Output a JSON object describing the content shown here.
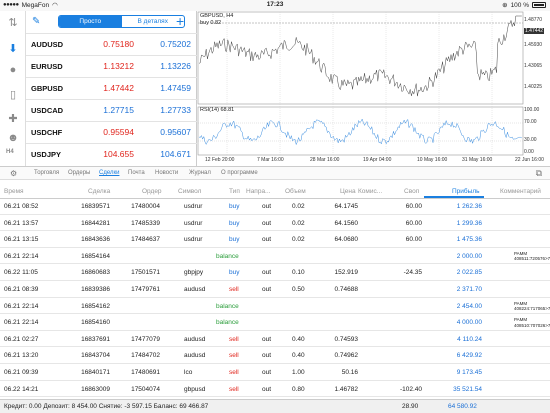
{
  "status_bar": {
    "carrier": "MegaFon",
    "time": "17:23",
    "battery": "100 %"
  },
  "quotes": {
    "tabs": [
      "Просто",
      "В деталях"
    ],
    "rows": [
      {
        "symbol": "AUDUSD",
        "bid": "0.75180",
        "ask": "0.75202",
        "bid_color": "red",
        "ask_color": "blue"
      },
      {
        "symbol": "EURUSD",
        "bid": "1.13212",
        "ask": "1.13226",
        "bid_color": "red",
        "ask_color": "blue"
      },
      {
        "symbol": "GBPUSD",
        "bid": "1.47442",
        "ask": "1.47459",
        "bid_color": "red",
        "ask_color": "blue"
      },
      {
        "symbol": "USDCAD",
        "bid": "1.27715",
        "ask": "1.27733",
        "bid_color": "blue",
        "ask_color": "blue"
      },
      {
        "symbol": "USDCHF",
        "bid": "0.95594",
        "ask": "0.95607",
        "bid_color": "red",
        "ask_color": "blue"
      },
      {
        "symbol": "USDJPY",
        "bid": "104.655",
        "ask": "104.671",
        "bid_color": "red",
        "ask_color": "blue"
      }
    ],
    "timeframe": "H4"
  },
  "chart": {
    "title": "GBPUSD, H4",
    "buy_label": "buy 0.82",
    "price_tag": "1.47442",
    "y_labels": [
      "1.48770",
      "1.45930",
      "1.43065",
      "1.40225"
    ],
    "rsi_label": "RSI(14) 68.81",
    "rsi_labels": [
      "100.00",
      "70.00",
      "30.00",
      "0.00"
    ],
    "x_labels": [
      "12 Feb 20:00",
      "7 Mar 16:00",
      "28 Mar 16:00",
      "19 Apr 04:00",
      "10 May 16:00",
      "31 May 16:00",
      "22 Jun 16:00"
    ]
  },
  "tabs": {
    "items": [
      "Торговля",
      "Ордеры",
      "Сделки",
      "Почта",
      "Новости",
      "Журнал",
      "О программе"
    ],
    "active": "Сделки"
  },
  "table": {
    "headers": [
      "Время",
      "Сделка",
      "Ордер",
      "Символ",
      "Тип",
      "Напра...",
      "Объем",
      "Цена",
      "Комис...",
      "Своп",
      "Прибыль",
      "Комментарий"
    ],
    "rows": [
      {
        "time": "06.21 08:52",
        "deal": "16839571",
        "order": "17480004",
        "symbol": "usdrur",
        "type": "buy",
        "dir": "out",
        "volume": "0.02",
        "price": "64.1745",
        "commission": "",
        "swap": "60.00",
        "profit": "1 262.36",
        "comment": ""
      },
      {
        "time": "06.21 13:57",
        "deal": "16844281",
        "order": "17485339",
        "symbol": "usdrur",
        "type": "buy",
        "dir": "out",
        "volume": "0.02",
        "price": "64.1560",
        "commission": "",
        "swap": "60.00",
        "profit": "1 299.36",
        "comment": ""
      },
      {
        "time": "06.21 13:15",
        "deal": "16843636",
        "order": "17484637",
        "symbol": "usdrur",
        "type": "buy",
        "dir": "out",
        "volume": "0.02",
        "price": "64.0680",
        "commission": "",
        "swap": "60.00",
        "profit": "1 475.36",
        "comment": ""
      },
      {
        "time": "06.21 22:14",
        "deal": "16854164",
        "order": "",
        "symbol": "",
        "type": "balance",
        "dir": "",
        "volume": "",
        "price": "",
        "commission": "",
        "swap": "",
        "profit": "2 000.00",
        "comment": "PAMM 408511:720576>711208"
      },
      {
        "time": "06.22 11:05",
        "deal": "16860683",
        "order": "17501571",
        "symbol": "gbpjpy",
        "type": "buy",
        "dir": "out",
        "volume": "0.10",
        "price": "152.919",
        "commission": "",
        "swap": "-24.35",
        "profit": "2 022.85",
        "comment": ""
      },
      {
        "time": "06.21 08:39",
        "deal": "16839386",
        "order": "17479761",
        "symbol": "audusd",
        "type": "sell",
        "dir": "out",
        "volume": "0.50",
        "price": "0.74688",
        "commission": "",
        "swap": "",
        "profit": "2 371.70",
        "comment": ""
      },
      {
        "time": "06.21 22:14",
        "deal": "16854162",
        "order": "",
        "symbol": "",
        "type": "balance",
        "dir": "",
        "volume": "",
        "price": "",
        "commission": "",
        "swap": "",
        "profit": "2 454.00",
        "comment": "PAMM 408224:717065>711208"
      },
      {
        "time": "06.21 22:14",
        "deal": "16854160",
        "order": "",
        "symbol": "",
        "type": "balance",
        "dir": "",
        "volume": "",
        "price": "",
        "commission": "",
        "swap": "",
        "profit": "4 000.00",
        "comment": "PAMM 408510:707026>711208"
      },
      {
        "time": "06.21 02:27",
        "deal": "16837691",
        "order": "17477079",
        "symbol": "audusd",
        "type": "sell",
        "dir": "out",
        "volume": "0.40",
        "price": "0.74593",
        "commission": "",
        "swap": "",
        "profit": "4 110.24",
        "comment": ""
      },
      {
        "time": "06.21 13:20",
        "deal": "16843704",
        "order": "17484702",
        "symbol": "audusd",
        "type": "sell",
        "dir": "out",
        "volume": "0.40",
        "price": "0.74962",
        "commission": "",
        "swap": "",
        "profit": "6 429.92",
        "comment": ""
      },
      {
        "time": "06.21 09:39",
        "deal": "16840171",
        "order": "17480691",
        "symbol": "lco",
        "type": "sell",
        "dir": "out",
        "volume": "1.00",
        "price": "50.16",
        "commission": "",
        "swap": "",
        "profit": "9 173.45",
        "comment": ""
      },
      {
        "time": "06.22 14:21",
        "deal": "16863009",
        "order": "17504074",
        "symbol": "gbpusd",
        "type": "sell",
        "dir": "out",
        "volume": "0.80",
        "price": "1.46782",
        "commission": "",
        "swap": "-102.40",
        "profit": "35 521.54",
        "comment": ""
      }
    ]
  },
  "footer": {
    "summary": "Кредит: 0.00 Депозит: 8 454.00 Снятие: -3 597.15 Баланс: 69 466.87",
    "swap_total": "28.90",
    "profit_total": "64 580.92"
  }
}
